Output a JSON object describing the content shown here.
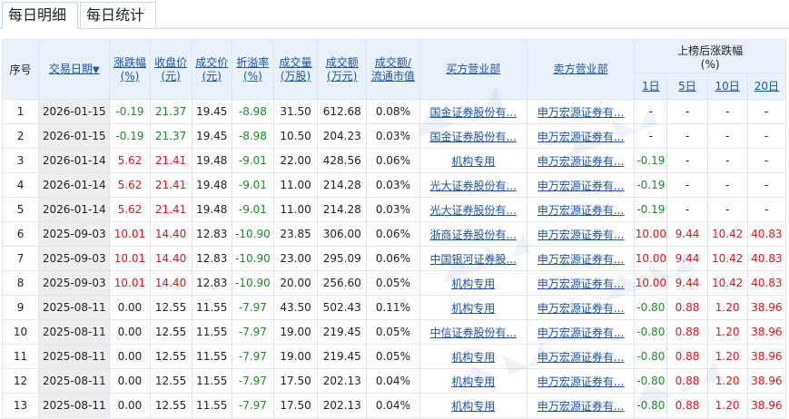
{
  "tabs": [
    {
      "label": "每日明细"
    },
    {
      "label": "每日统计"
    }
  ],
  "headers": {
    "seq": "序号",
    "date": "交易日期",
    "change": "涨跌幅(%)",
    "close": "收盘价(元)",
    "price": "成交价(元)",
    "premium": "折溢率(%)",
    "volume": "成交量(万股)",
    "amount": "成交额(万元)",
    "ratio": "成交额/流通市值",
    "buyer": "买方营业部",
    "seller": "卖方营业部",
    "post": "上榜后涨跌幅(%)",
    "d1": "1日",
    "d5": "5日",
    "d10": "10日",
    "d20": "20日"
  },
  "rows": [
    {
      "seq": "1",
      "date": "2026-01-15",
      "change": "-0.19",
      "close": "21.37",
      "price": "19.45",
      "premium": "-8.98",
      "volume": "31.50",
      "amount": "612.68",
      "ratio": "0.08%",
      "buyer": "国金证券股份有...",
      "seller": "申万宏源证券有...",
      "d1": "-",
      "d5": "-",
      "d10": "-",
      "d20": "-"
    },
    {
      "seq": "2",
      "date": "2026-01-15",
      "change": "-0.19",
      "close": "21.37",
      "price": "19.45",
      "premium": "-8.98",
      "volume": "10.50",
      "amount": "204.23",
      "ratio": "0.03%",
      "buyer": "国金证券股份有...",
      "seller": "申万宏源证券有...",
      "d1": "-",
      "d5": "-",
      "d10": "-",
      "d20": "-"
    },
    {
      "seq": "3",
      "date": "2026-01-14",
      "change": "5.62",
      "close": "21.41",
      "price": "19.48",
      "premium": "-9.01",
      "volume": "22.00",
      "amount": "428.56",
      "ratio": "0.06%",
      "buyer": "机构专用",
      "seller": "申万宏源证券有...",
      "d1": "-0.19",
      "d5": "-",
      "d10": "-",
      "d20": "-"
    },
    {
      "seq": "4",
      "date": "2026-01-14",
      "change": "5.62",
      "close": "21.41",
      "price": "19.48",
      "premium": "-9.01",
      "volume": "11.00",
      "amount": "214.28",
      "ratio": "0.03%",
      "buyer": "光大证券股份有...",
      "seller": "申万宏源证券有...",
      "d1": "-0.19",
      "d5": "-",
      "d10": "-",
      "d20": "-"
    },
    {
      "seq": "5",
      "date": "2026-01-14",
      "change": "5.62",
      "close": "21.41",
      "price": "19.48",
      "premium": "-9.01",
      "volume": "11.00",
      "amount": "214.28",
      "ratio": "0.03%",
      "buyer": "光大证券股份有...",
      "seller": "申万宏源证券有...",
      "d1": "-0.19",
      "d5": "-",
      "d10": "-",
      "d20": "-"
    },
    {
      "seq": "6",
      "date": "2025-09-03",
      "change": "10.01",
      "close": "14.40",
      "price": "12.83",
      "premium": "-10.90",
      "volume": "23.85",
      "amount": "306.00",
      "ratio": "0.06%",
      "buyer": "浙商证券股份有...",
      "seller": "申万宏源证券有...",
      "d1": "10.00",
      "d5": "9.44",
      "d10": "10.42",
      "d20": "40.83"
    },
    {
      "seq": "7",
      "date": "2025-09-03",
      "change": "10.01",
      "close": "14.40",
      "price": "12.83",
      "premium": "-10.90",
      "volume": "23.00",
      "amount": "295.09",
      "ratio": "0.06%",
      "buyer": "中国银河证券股...",
      "seller": "申万宏源证券有...",
      "d1": "10.00",
      "d5": "9.44",
      "d10": "10.42",
      "d20": "40.83"
    },
    {
      "seq": "8",
      "date": "2025-09-03",
      "change": "10.01",
      "close": "14.40",
      "price": "12.83",
      "premium": "-10.90",
      "volume": "20.00",
      "amount": "256.60",
      "ratio": "0.05%",
      "buyer": "机构专用",
      "seller": "申万宏源证券有...",
      "d1": "10.00",
      "d5": "9.44",
      "d10": "10.42",
      "d20": "40.83"
    },
    {
      "seq": "9",
      "date": "2025-08-11",
      "change": "0.00",
      "close": "12.55",
      "price": "11.55",
      "premium": "-7.97",
      "volume": "43.50",
      "amount": "502.43",
      "ratio": "0.11%",
      "buyer": "机构专用",
      "seller": "申万宏源证券有...",
      "d1": "-0.80",
      "d5": "0.88",
      "d10": "1.20",
      "d20": "38.96"
    },
    {
      "seq": "10",
      "date": "2025-08-11",
      "change": "0.00",
      "close": "12.55",
      "price": "11.55",
      "premium": "-7.97",
      "volume": "19.00",
      "amount": "219.45",
      "ratio": "0.05%",
      "buyer": "中信证券股份有...",
      "seller": "申万宏源证券有...",
      "d1": "-0.80",
      "d5": "0.88",
      "d10": "1.20",
      "d20": "38.96"
    },
    {
      "seq": "11",
      "date": "2025-08-11",
      "change": "0.00",
      "close": "12.55",
      "price": "11.55",
      "premium": "-7.97",
      "volume": "19.00",
      "amount": "219.45",
      "ratio": "0.05%",
      "buyer": "机构专用",
      "seller": "申万宏源证券有...",
      "d1": "-0.80",
      "d5": "0.88",
      "d10": "1.20",
      "d20": "38.96"
    },
    {
      "seq": "12",
      "date": "2025-08-11",
      "change": "0.00",
      "close": "12.55",
      "price": "11.55",
      "premium": "-7.97",
      "volume": "17.50",
      "amount": "202.13",
      "ratio": "0.04%",
      "buyer": "机构专用",
      "seller": "申万宏源证券有...",
      "d1": "-0.80",
      "d5": "0.88",
      "d10": "1.20",
      "d20": "38.96"
    },
    {
      "seq": "13",
      "date": "2025-08-11",
      "change": "0.00",
      "close": "12.55",
      "price": "11.55",
      "premium": "-7.97",
      "volume": "17.50",
      "amount": "202.13",
      "ratio": "0.04%",
      "buyer": "机构专用",
      "seller": "申万宏源证券有...",
      "d1": "-0.80",
      "d5": "0.88",
      "d10": "1.20",
      "d20": "38.96"
    }
  ],
  "colors": {
    "up": "#e0161c",
    "down": "#1b8c2a",
    "link": "#1a54a8"
  },
  "icons": {
    "sort": "sort-down-arrow-icon"
  }
}
